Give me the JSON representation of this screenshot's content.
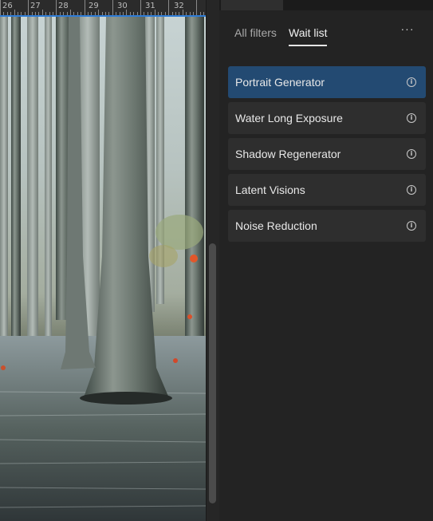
{
  "ruler": {
    "numbers": [
      "26",
      "27",
      "28",
      "29",
      "30",
      "31",
      "32"
    ]
  },
  "panel": {
    "tabs": [
      {
        "label": "All filters",
        "active": false
      },
      {
        "label": "Wait list",
        "active": true
      }
    ],
    "more_label": "···",
    "filters": [
      {
        "label": "Portrait Generator",
        "selected": true,
        "icon": "info-icon"
      },
      {
        "label": "Water Long Exposure",
        "selected": false,
        "icon": "info-icon"
      },
      {
        "label": "Shadow Regenerator",
        "selected": false,
        "icon": "info-icon"
      },
      {
        "label": "Latent Visions",
        "selected": false,
        "icon": "info-icon"
      },
      {
        "label": "Noise Reduction",
        "selected": false,
        "icon": "info-icon"
      }
    ]
  },
  "colors": {
    "selected_item": "#234a72",
    "ruler_accent": "#2d7bd6",
    "panel_bg": "#232323"
  }
}
